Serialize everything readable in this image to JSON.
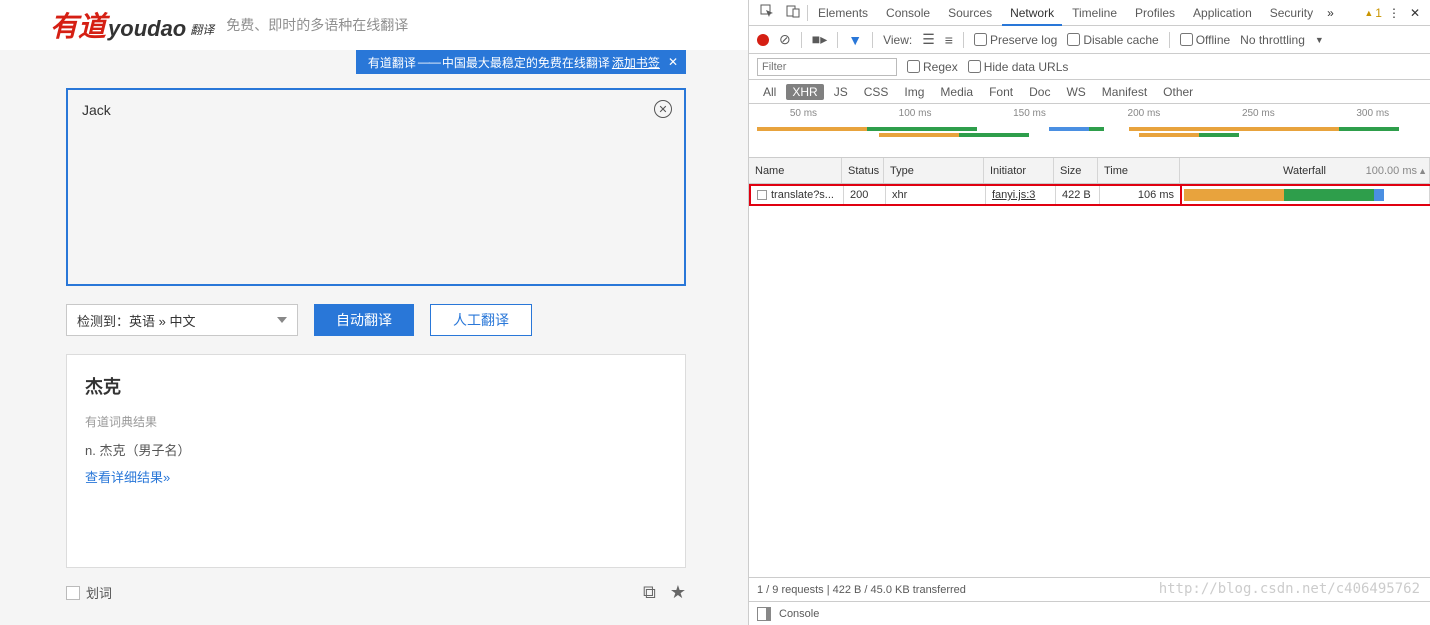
{
  "header": {
    "logo_zh": "有道",
    "logo_py": "youdao",
    "logo_sub": "翻译",
    "tagline": "免费、即时的多语种在线翻译"
  },
  "banner": {
    "label": "有道翻译",
    "dash": "——",
    "desc": "中国最大最稳定的免费在线翻译",
    "link": "添加书签",
    "close": "✕"
  },
  "input": {
    "text": "Jack",
    "clear": "✕"
  },
  "controls": {
    "lang": "检测到：英语 » 中文",
    "auto": "自动翻译",
    "human": "人工翻译"
  },
  "result": {
    "title": "杰克",
    "dict_label": "有道词典结果",
    "def": "n. 杰克（男子名）",
    "more": "查看详细结果»"
  },
  "footer": {
    "huaci": "划词"
  },
  "devtools": {
    "tabs": [
      "Elements",
      "Console",
      "Sources",
      "Network",
      "Timeline",
      "Profiles",
      "Application",
      "Security"
    ],
    "active_tab": "Network",
    "warnings": "1",
    "toolbar": {
      "view": "View:",
      "preserve": "Preserve log",
      "disable_cache": "Disable cache",
      "offline": "Offline",
      "throttling": "No throttling"
    },
    "filter": {
      "placeholder": "Filter",
      "regex": "Regex",
      "hide": "Hide data URLs"
    },
    "cats": [
      "All",
      "XHR",
      "JS",
      "CSS",
      "Img",
      "Media",
      "Font",
      "Doc",
      "WS",
      "Manifest",
      "Other"
    ],
    "cat_sel": "XHR",
    "timeline_ticks": [
      "50 ms",
      "100 ms",
      "150 ms",
      "200 ms",
      "250 ms",
      "300 ms"
    ],
    "grid": {
      "cols": [
        "Name",
        "Status",
        "Type",
        "Initiator",
        "Size",
        "Time",
        "Waterfall"
      ],
      "wf_label": "100.00 ms",
      "rows": [
        {
          "name": "translate?s...",
          "status": "200",
          "type": "xhr",
          "initiator": "fanyi.js:3",
          "size": "422 B",
          "time": "106 ms"
        }
      ]
    },
    "status": "1 / 9 requests  |  422 B / 45.0 KB transferred",
    "drawer": "Console"
  },
  "watermark": "http://blog.csdn.net/c406495762"
}
